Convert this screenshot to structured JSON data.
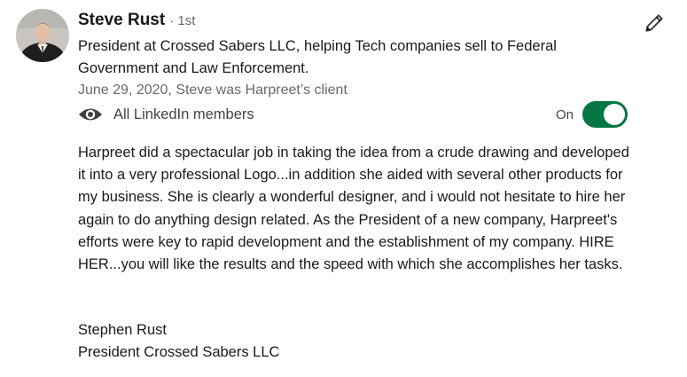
{
  "recommender": {
    "name": "Steve Rust",
    "degree": "· 1st",
    "headline": "President at Crossed Sabers LLC, helping Tech companies sell to Federal Government and Law Enforcement.",
    "date_relation": "June 29, 2020, Steve was Harpreet’s client"
  },
  "visibility": {
    "icon": "eye-icon",
    "label": "All LinkedIn members",
    "toggle_label": "On",
    "toggle_on": true,
    "toggle_color": "#057642"
  },
  "recommendation": {
    "text": "Harpreet did a spectacular job in taking the idea from a crude drawing and developed it into a very professional Logo...in addition she aided with several other products for my business. She is clearly a wonderful designer, and i would not hesitate to hire her again to do anything design related. As the President of a new company, Harpreet's efforts were key to rapid development and the establishment of my company. HIRE HER...you will like the results and the speed with which she accomplishes her tasks.",
    "signature_name": "Stephen Rust",
    "signature_title": "President Crossed Sabers LLC"
  },
  "actions": {
    "edit_icon": "pencil-icon"
  }
}
